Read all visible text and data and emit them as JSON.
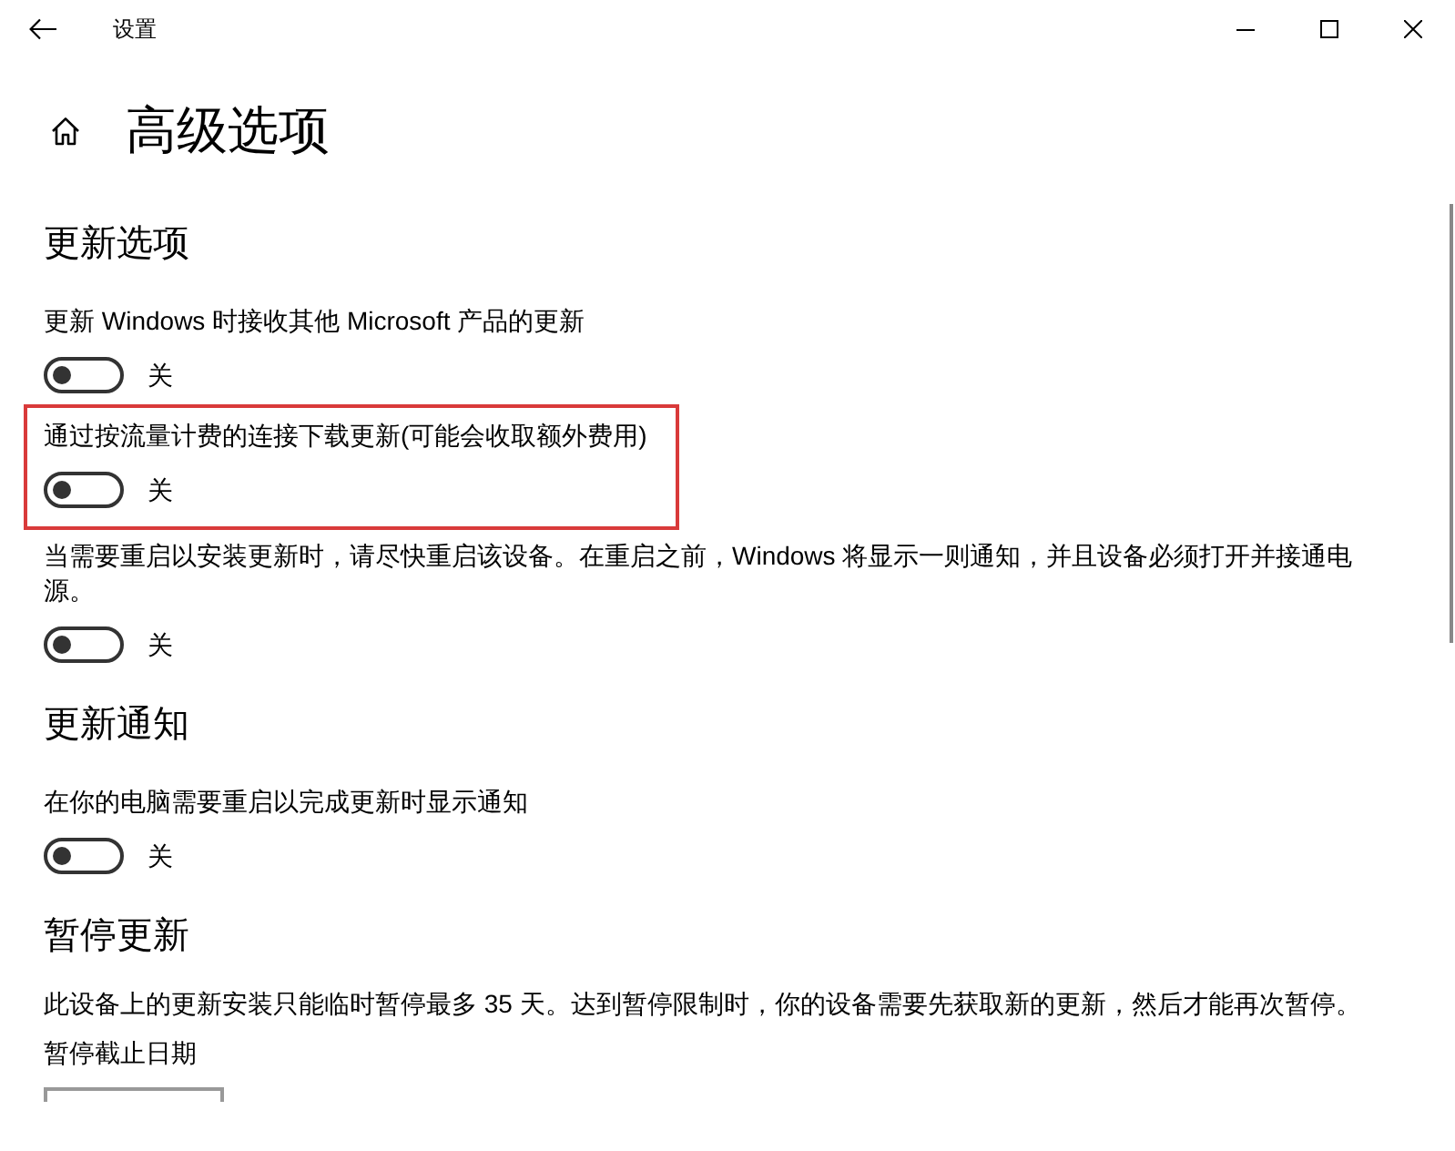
{
  "window": {
    "title": "设置"
  },
  "page": {
    "title": "高级选项"
  },
  "sections": [
    {
      "title": "更新选项",
      "options": [
        {
          "kind": "toggle",
          "label": "更新 Windows 时接收其他 Microsoft 产品的更新",
          "on": false,
          "state_label": "关",
          "highlighted": false
        },
        {
          "kind": "toggle",
          "label": "通过按流量计费的连接下载更新(可能会收取额外费用)",
          "on": false,
          "state_label": "关",
          "highlighted": true
        },
        {
          "kind": "toggle",
          "label": "当需要重启以安装更新时，请尽快重启该设备。在重启之前，Windows 将显示一则通知，并且设备必须打开并接通电源。",
          "on": false,
          "state_label": "关",
          "highlighted": false
        }
      ]
    },
    {
      "title": "更新通知",
      "options": [
        {
          "kind": "toggle",
          "label": "在你的电脑需要重启以完成更新时显示通知",
          "on": false,
          "state_label": "关",
          "highlighted": false
        }
      ]
    },
    {
      "title": "暂停更新",
      "options": [
        {
          "kind": "text",
          "text": "此设备上的更新安装只能临时暂停最多 35 天。达到暂停限制时，你的设备需要先获取新的更新，然后才能再次暂停。"
        },
        {
          "kind": "dropdown",
          "label": "暂停截止日期"
        }
      ]
    }
  ]
}
